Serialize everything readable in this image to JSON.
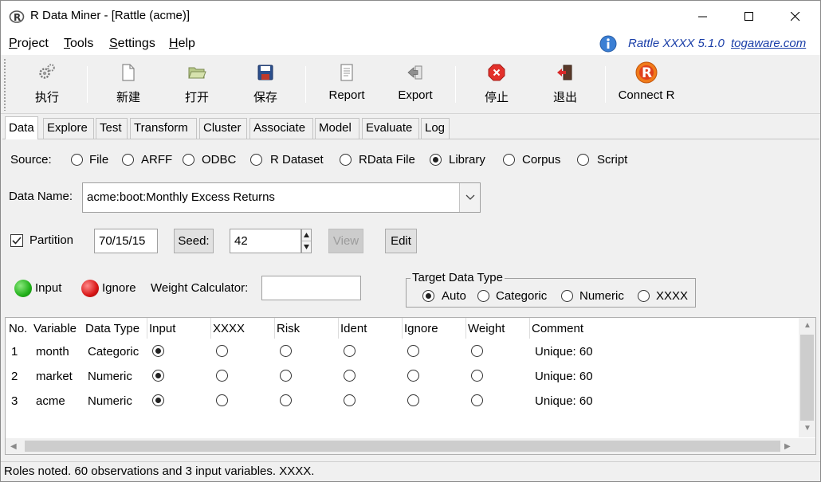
{
  "window": {
    "title": "R Data Miner - [Rattle (acme)]",
    "controls": {
      "minimize": "minimize",
      "maximize": "maximize",
      "close": "close"
    }
  },
  "menu": {
    "items": [
      {
        "label": "Project",
        "accel": "P",
        "rest": "roject"
      },
      {
        "label": "Tools",
        "accel": "T",
        "rest": "ools"
      },
      {
        "label": "Settings",
        "accel": "S",
        "rest": "ettings"
      },
      {
        "label": "Help",
        "accel": "H",
        "rest": "elp"
      }
    ],
    "rattle_version": "Rattle XXXX 5.1.0",
    "rattle_link": "togaware.com"
  },
  "toolbar": {
    "execute": "执行",
    "new": "新建",
    "open": "打开",
    "save": "保存",
    "report": "Report",
    "export": "Export",
    "stop": "停止",
    "quit": "退出",
    "connect_r": "Connect R"
  },
  "tabs": [
    "Data",
    "Explore",
    "Test",
    "Transform",
    "Cluster",
    "Associate",
    "Model",
    "Evaluate",
    "Log"
  ],
  "active_tab": "Data",
  "source": {
    "label": "Source:",
    "options": [
      "File",
      "ARFF",
      "ODBC",
      "R Dataset",
      "RData File",
      "Library",
      "Corpus",
      "Script"
    ],
    "selected": "Library"
  },
  "data_name": {
    "label": "Data Name:",
    "value": "acme:boot:Monthly Excess Returns"
  },
  "partition": {
    "label": "Partition",
    "checked": true,
    "value": "70/15/15",
    "seed_label": "Seed:",
    "seed_value": "42",
    "view_label": "View",
    "edit_label": "Edit"
  },
  "roles": {
    "input_label": "Input",
    "ignore_label": "Ignore",
    "weight_label": "Weight Calculator:",
    "weight_value": "",
    "input_color": "#22b11a",
    "ignore_color": "#d81616"
  },
  "target_type": {
    "title": "Target Data Type",
    "options": [
      "Auto",
      "Categoric",
      "Numeric",
      "XXXX"
    ],
    "selected": "Auto"
  },
  "table": {
    "headers": [
      "No.",
      "Variable",
      "Data Type",
      "Input",
      "XXXX",
      "Risk",
      "Ident",
      "Ignore",
      "Weight",
      "Comment"
    ],
    "rows": [
      {
        "no": "1",
        "variable": "month",
        "type": "Categoric",
        "role": "Input",
        "comment": "Unique: 60"
      },
      {
        "no": "2",
        "variable": "market",
        "type": "Numeric",
        "role": "Input",
        "comment": "Unique: 60"
      },
      {
        "no": "3",
        "variable": "acme",
        "type": "Numeric",
        "role": "Input",
        "comment": "Unique: 60"
      }
    ]
  },
  "status": "Roles noted. 60 observations and 3 input variables. XXXX."
}
